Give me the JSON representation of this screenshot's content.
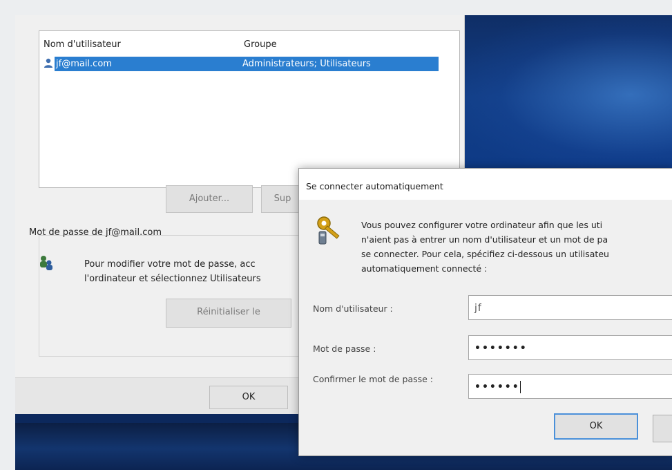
{
  "user_accounts": {
    "columns": {
      "username": "Nom d'utilisateur",
      "group": "Groupe"
    },
    "selected_user": {
      "username": "jf@mail.com",
      "group": "Administrateurs; Utilisateurs"
    },
    "buttons": {
      "add": "Ajouter...",
      "remove": "Sup",
      "reset": "Réinitialiser le",
      "ok": "OK"
    },
    "password_section_title": "Mot de passe de jf@mail.com",
    "password_help": "Pour modifier votre mot de passe, acc\nl'ordinateur et sélectionnez Utilisateurs"
  },
  "auto_login_dialog": {
    "title": "Se connecter automatiquement",
    "description": "Vous pouvez configurer votre ordinateur afin que les uti\nn'aient pas à entrer un nom d'utilisateur et un mot de pa\nse connecter. Pour cela, spécifiez ci-dessous un utilisateu\nautomatiquement connecté :",
    "fields": {
      "username_label": "Nom d'utilisateur :",
      "username_value": "jf",
      "password_label": "Mot de passe :",
      "password_value": "•••••••",
      "confirm_label": "Confirmer le mot de passe :",
      "confirm_value": "••••••"
    },
    "buttons": {
      "ok": "OK"
    }
  }
}
